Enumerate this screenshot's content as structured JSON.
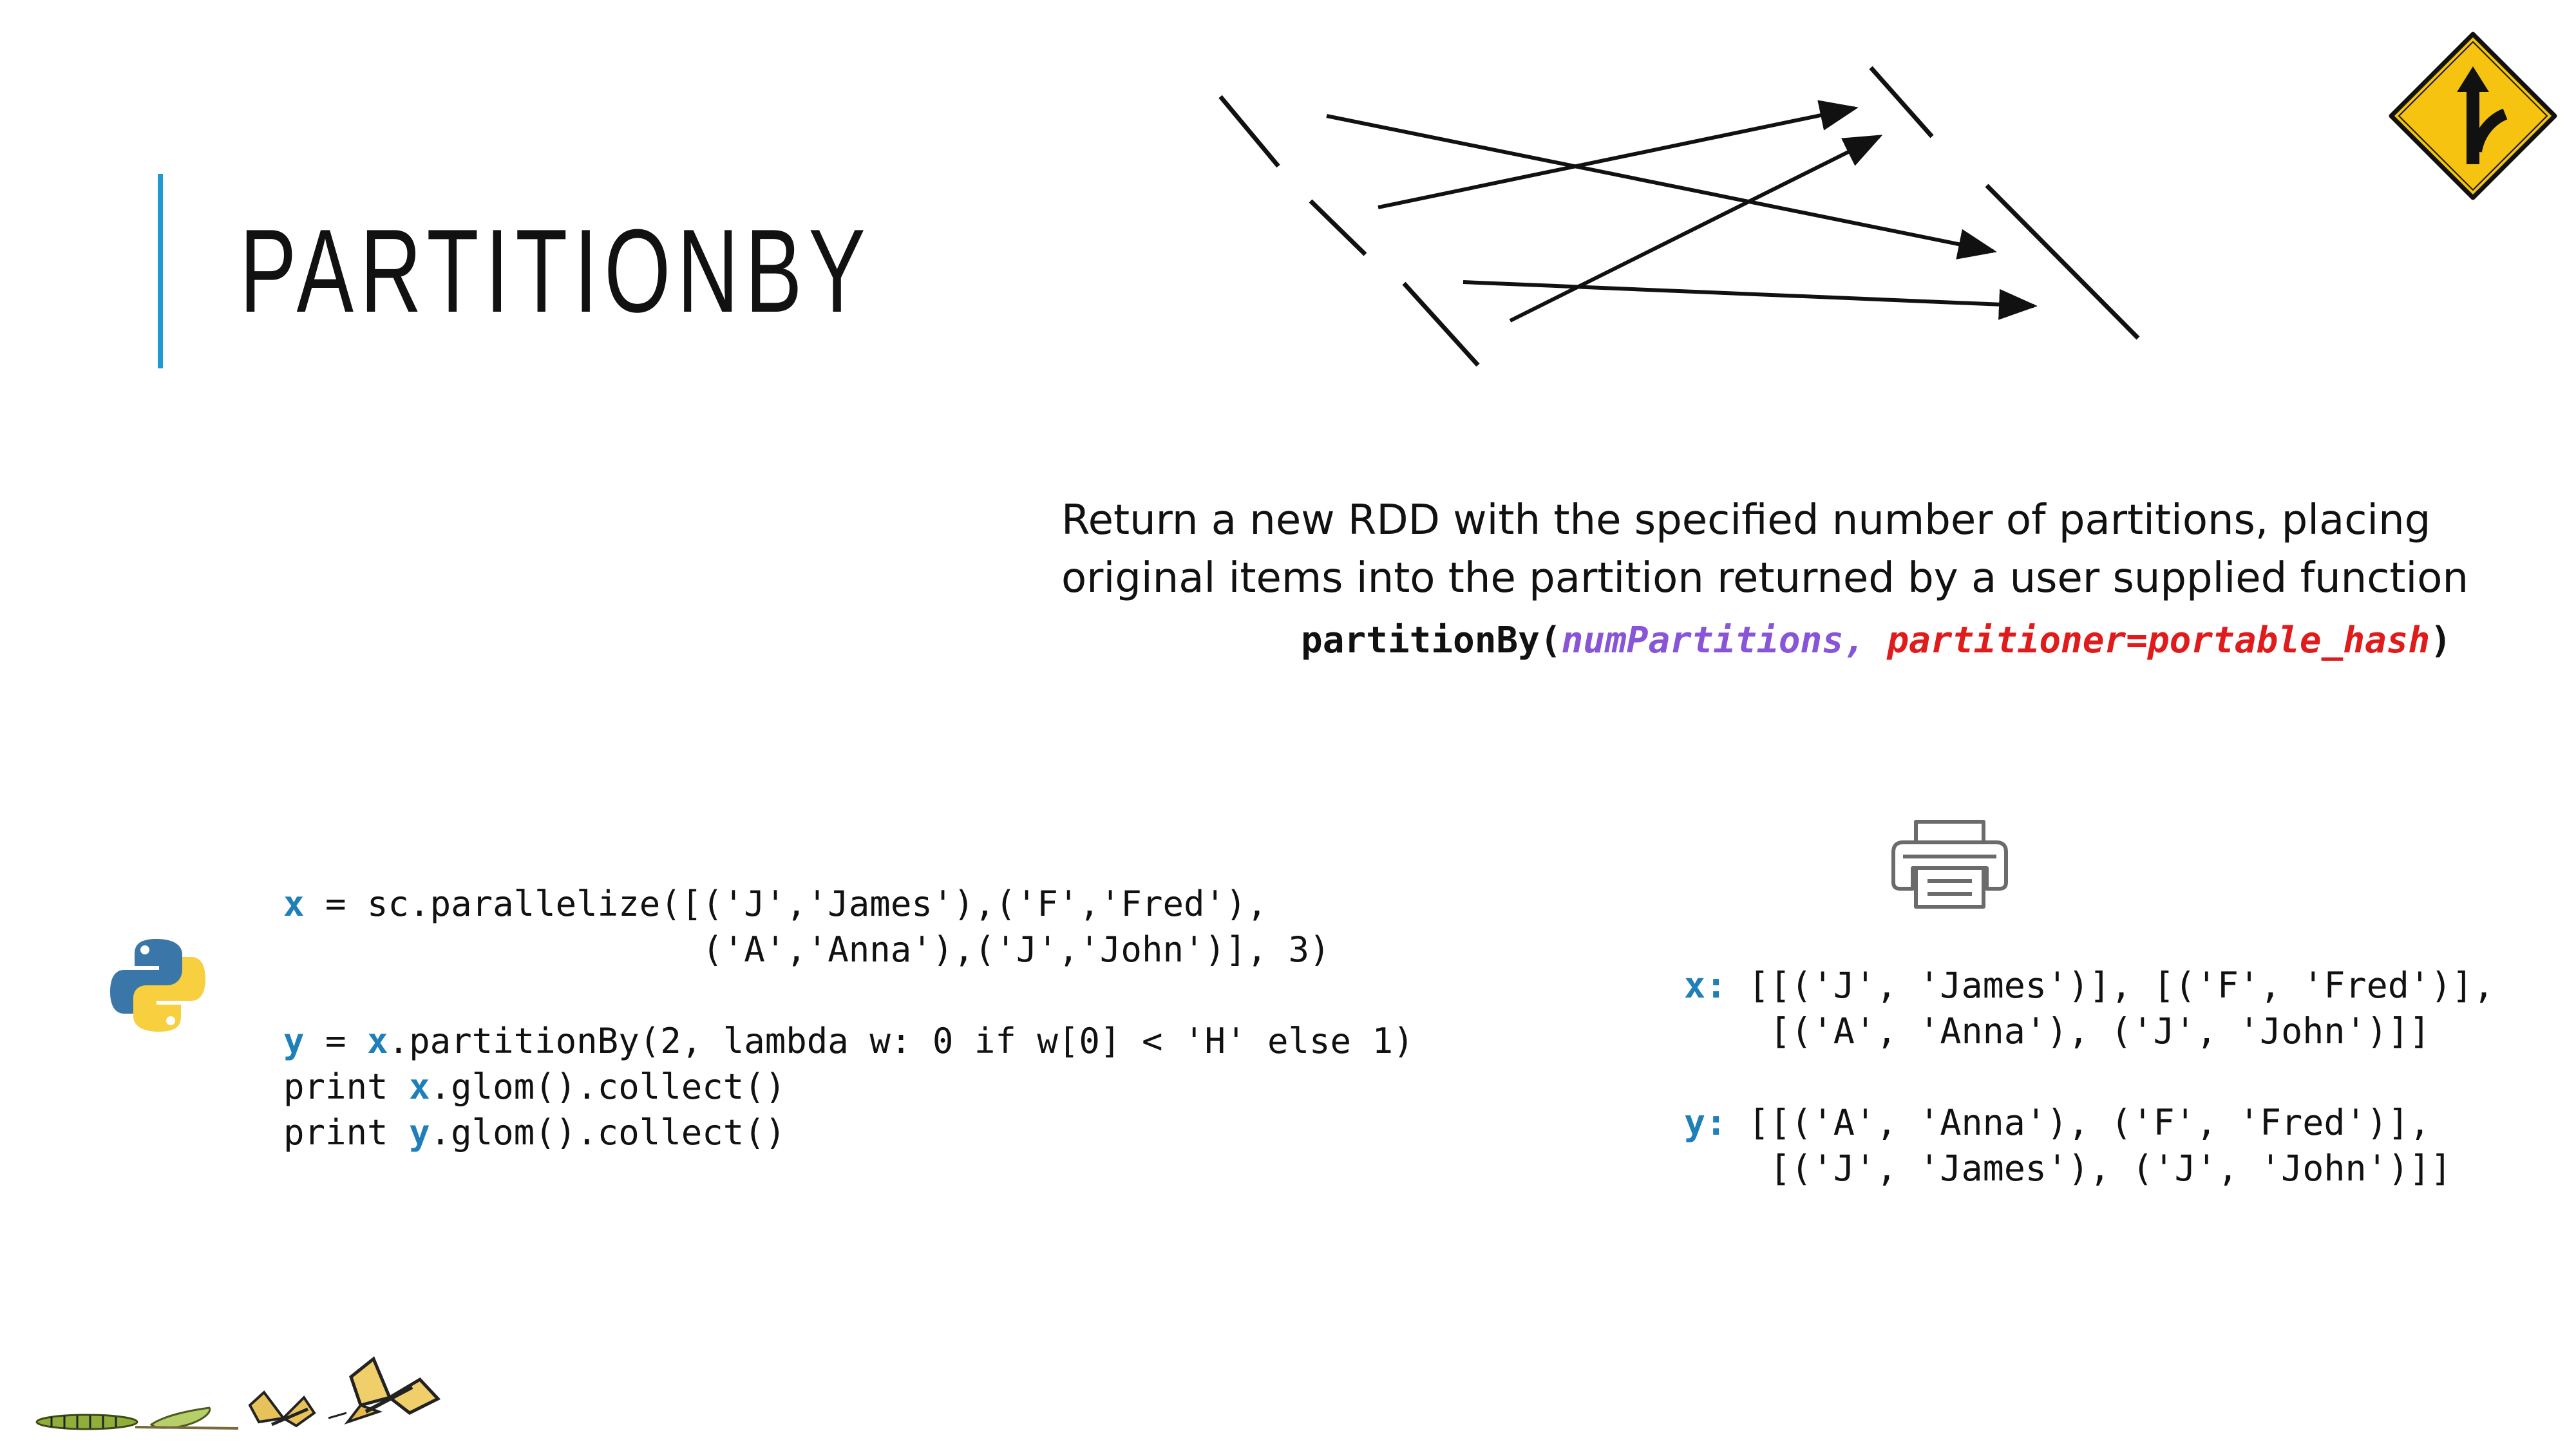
{
  "slide": {
    "title": "PARTITIONBY",
    "description": "Return a new RDD with the specified number of partitions, placing original items into the partition returned by a user supplied function",
    "signature": {
      "name": "partitionBy(",
      "param1": "numPartitions,",
      "space": " ",
      "param2": "partitioner=portable_hash",
      "close": ")"
    },
    "code": {
      "line1_var": "x",
      "line1_rest": " = sc.parallelize([('J','James'),('F','Fred'),",
      "line2": "                    ('A','Anna'),('J','John')], 3)",
      "line4_var": "y",
      "line4_eq": " = ",
      "line4_var2": "x",
      "line4_rest": ".partitionBy(2, lambda w: 0 if w[0] < 'H' else 1)",
      "line5_pre": "print ",
      "line5_var": "x",
      "line5_rest": ".glom().collect()",
      "line6_pre": "print ",
      "line6_var": "y",
      "line6_rest": ".glom().collect()"
    },
    "output": {
      "x_label": "x:",
      "x_line1": " [[('J', 'James')], [('F', 'Fred')],",
      "x_line2": "    [('A', 'Anna'), ('J', 'John')]]",
      "y_label": "y:",
      "y_line1": " [[('A', 'Anna'), ('F', 'Fred')],",
      "y_line2": "    [('J', 'James'), ('J', 'John')]]"
    },
    "colors": {
      "accent": "#1f9bd1",
      "variable": "#1f7fb8",
      "param_purple": "#8855d6",
      "param_red": "#e01b1b",
      "sign_yellow": "#f6c410"
    },
    "icons": [
      "merge-sign-icon",
      "python-logo-icon",
      "printer-icon",
      "butterfly-lifecycle-icon"
    ]
  }
}
